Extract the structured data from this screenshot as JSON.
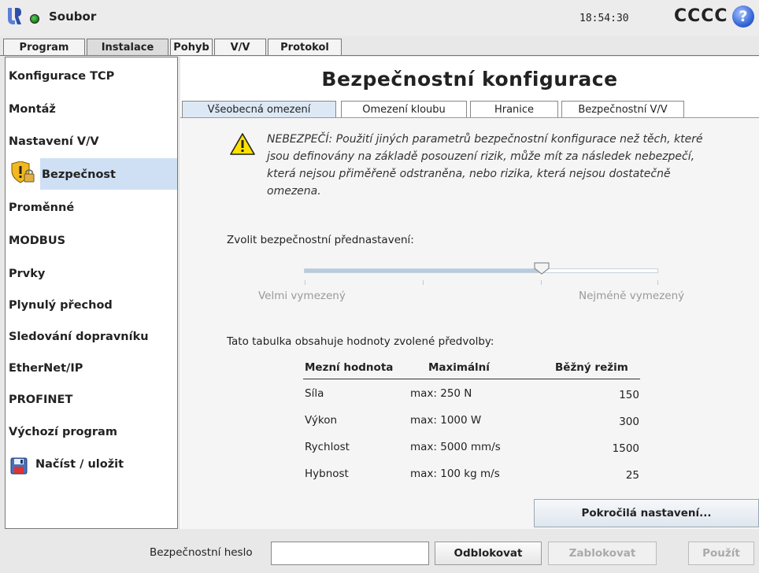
{
  "topbar": {
    "file_menu": "Soubor",
    "time": "18:54:30",
    "robot_name": "CCCC",
    "help": "?"
  },
  "main_tabs": [
    {
      "label": "Program"
    },
    {
      "label": "Instalace"
    },
    {
      "label": "Pohyb"
    },
    {
      "label": "V/V"
    },
    {
      "label": "Protokol"
    }
  ],
  "active_main_tab": "Instalace",
  "sidebar": {
    "items": [
      {
        "label": "Konfigurace TCP"
      },
      {
        "label": "Montáž"
      },
      {
        "label": "Nastavení V/V"
      },
      {
        "label": "Bezpečnost"
      },
      {
        "label": "Proměnné"
      },
      {
        "label": "MODBUS"
      },
      {
        "label": "Prvky"
      },
      {
        "label": "Plynulý přechod"
      },
      {
        "label": "Sledování dopravníku"
      },
      {
        "label": "EtherNet/IP"
      },
      {
        "label": "PROFINET"
      },
      {
        "label": "Výchozí program"
      },
      {
        "label": "Načíst / uložit"
      }
    ],
    "selected": "Bezpečnost",
    "icons": {
      "security": "shield-lock-icon",
      "load_save": "floppy-disk-icon"
    }
  },
  "content": {
    "title": "Bezpečnostní konfigurace",
    "tabs": [
      {
        "label": "Všeobecná omezení"
      },
      {
        "label": "Omezení kloubu"
      },
      {
        "label": "Hranice"
      },
      {
        "label": "Bezpečnostní V/V"
      }
    ],
    "active_tab": "Všeobecná omezení",
    "warning": "NEBEZPEČÍ: Použití jiných parametrů bezpečnostní konfigurace než těch, které jsou definovány na základě posouzení rizik, může mít za následek nebezpečí, která nejsou přiměřeně odstraněna, nebo rizika, která nejsou dostatečně omezena.",
    "preset_label": "Zvolit bezpečnostní přednastavení:",
    "slider": {
      "min_label": "Velmi vymezený",
      "max_label": "Nejméně vymezený",
      "value_fraction": 0.67
    },
    "table_caption": "Tato tabulka obsahuje hodnoty zvolené předvolby:",
    "table": {
      "headers": [
        "Mezní hodnota",
        "Maximální",
        "Běžný režim"
      ],
      "rows": [
        [
          "Síla",
          "max: 250 N",
          "150"
        ],
        [
          "Výkon",
          "max: 1000 W",
          "300"
        ],
        [
          "Rychlost",
          "max: 5000 mm/s",
          "1500"
        ],
        [
          "Hybnost",
          "max: 100 kg m/s",
          "25"
        ]
      ]
    },
    "advanced_button": "Pokročilá nastavení..."
  },
  "bottombar": {
    "password_label": "Bezpečnostní heslo",
    "password_value": "",
    "unlock": "Odblokovat",
    "lock": "Zablokovat",
    "apply": "Použít"
  },
  "colors": {
    "selection": "#cfe0f4",
    "help": "#3767d8",
    "status_ok": "#1a8a1a"
  }
}
